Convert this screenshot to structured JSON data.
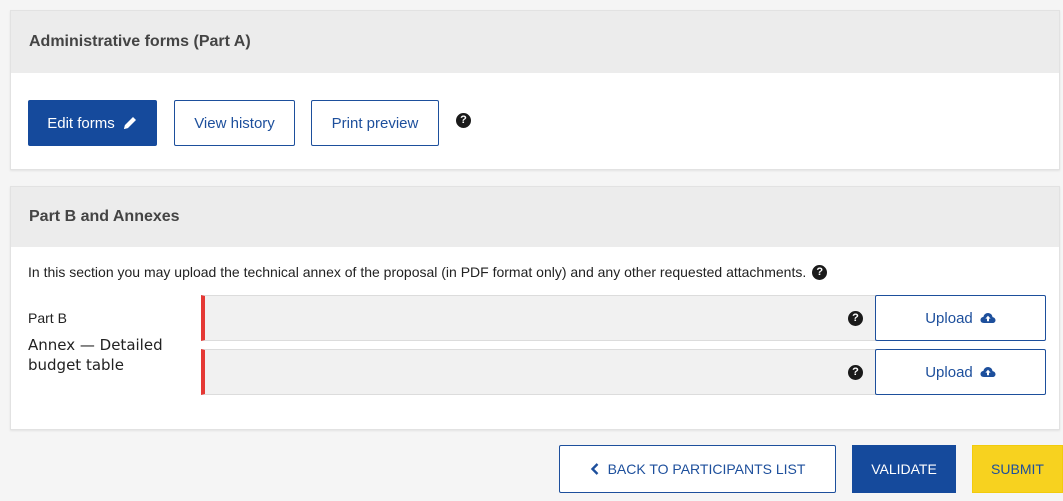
{
  "part_a": {
    "title": "Administrative forms (Part A)",
    "edit_label": "Edit forms",
    "history_label": "View history",
    "preview_label": "Print preview"
  },
  "part_b": {
    "title": "Part B and Annexes",
    "description": "In this section you may upload the technical annex of the proposal (in PDF format only) and any other requested attachments.",
    "rows": [
      {
        "label": "Part B",
        "upload_label": "Upload"
      },
      {
        "label": "Annex — Detailed budget table",
        "upload_label": "Upload"
      }
    ]
  },
  "footer": {
    "back_label": "BACK TO PARTICIPANTS LIST",
    "validate_label": "VALIDATE",
    "submit_label": "SUBMIT"
  },
  "icons": {
    "edit": "pencil-icon",
    "help": "question-circle-icon",
    "upload": "cloud-upload-icon",
    "back": "chevron-left-icon"
  },
  "colors": {
    "primary": "#154a9c",
    "submit": "#f7d21f",
    "required_marker": "#e53935"
  }
}
